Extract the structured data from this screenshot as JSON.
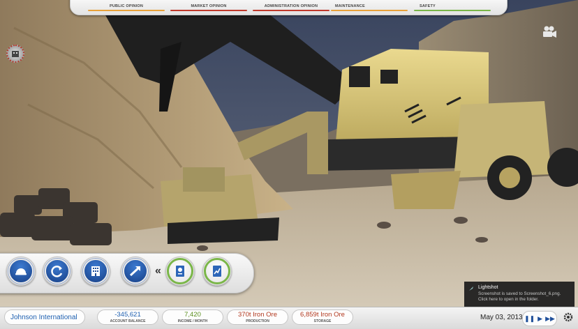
{
  "top_panel": {
    "meters": [
      {
        "label": "PUBLIC OPINION",
        "color": "#e8a13a"
      },
      {
        "label": "MARKET OPINION",
        "color": "#c0392b"
      },
      {
        "label": "ADMINISTRATION OPINION",
        "color": "#c0392b"
      },
      {
        "label": "MAINTENANCE",
        "color": "#e8a13a"
      },
      {
        "label": "SAFETY",
        "color": "#7ab648"
      }
    ]
  },
  "dock": {
    "buttons": [
      {
        "icon": "hardhat-icon"
      },
      {
        "icon": "cycle-icon"
      },
      {
        "icon": "building-icon"
      },
      {
        "icon": "trend-up-icon"
      }
    ],
    "collapse_glyph": "«",
    "extra_buttons": [
      {
        "icon": "document-icon"
      },
      {
        "icon": "chart-icon"
      }
    ]
  },
  "status_bar": {
    "company": "Johnson International",
    "stats": [
      {
        "value": "-345,621",
        "caption": "ACCOUNT BALANCE",
        "color": "#1d5fb0"
      },
      {
        "value": "7,420",
        "caption": "INCOME / MONTH",
        "color": "#5a8f1e"
      },
      {
        "value": "370t Iron Ore",
        "caption": "PRODUCTION",
        "color": "#b2381e"
      },
      {
        "value": "6,859t Iron Ore",
        "caption": "STORAGE",
        "color": "#b2381e"
      }
    ],
    "date": "May 03, 2013",
    "speed_controls": [
      "❚❚",
      "▶",
      "▶▶"
    ]
  },
  "toast": {
    "title": "Lightshot",
    "message_line1": "Screenshot is saved to Screenshot_6.png.",
    "message_line2": "Click here to open in the folder."
  }
}
